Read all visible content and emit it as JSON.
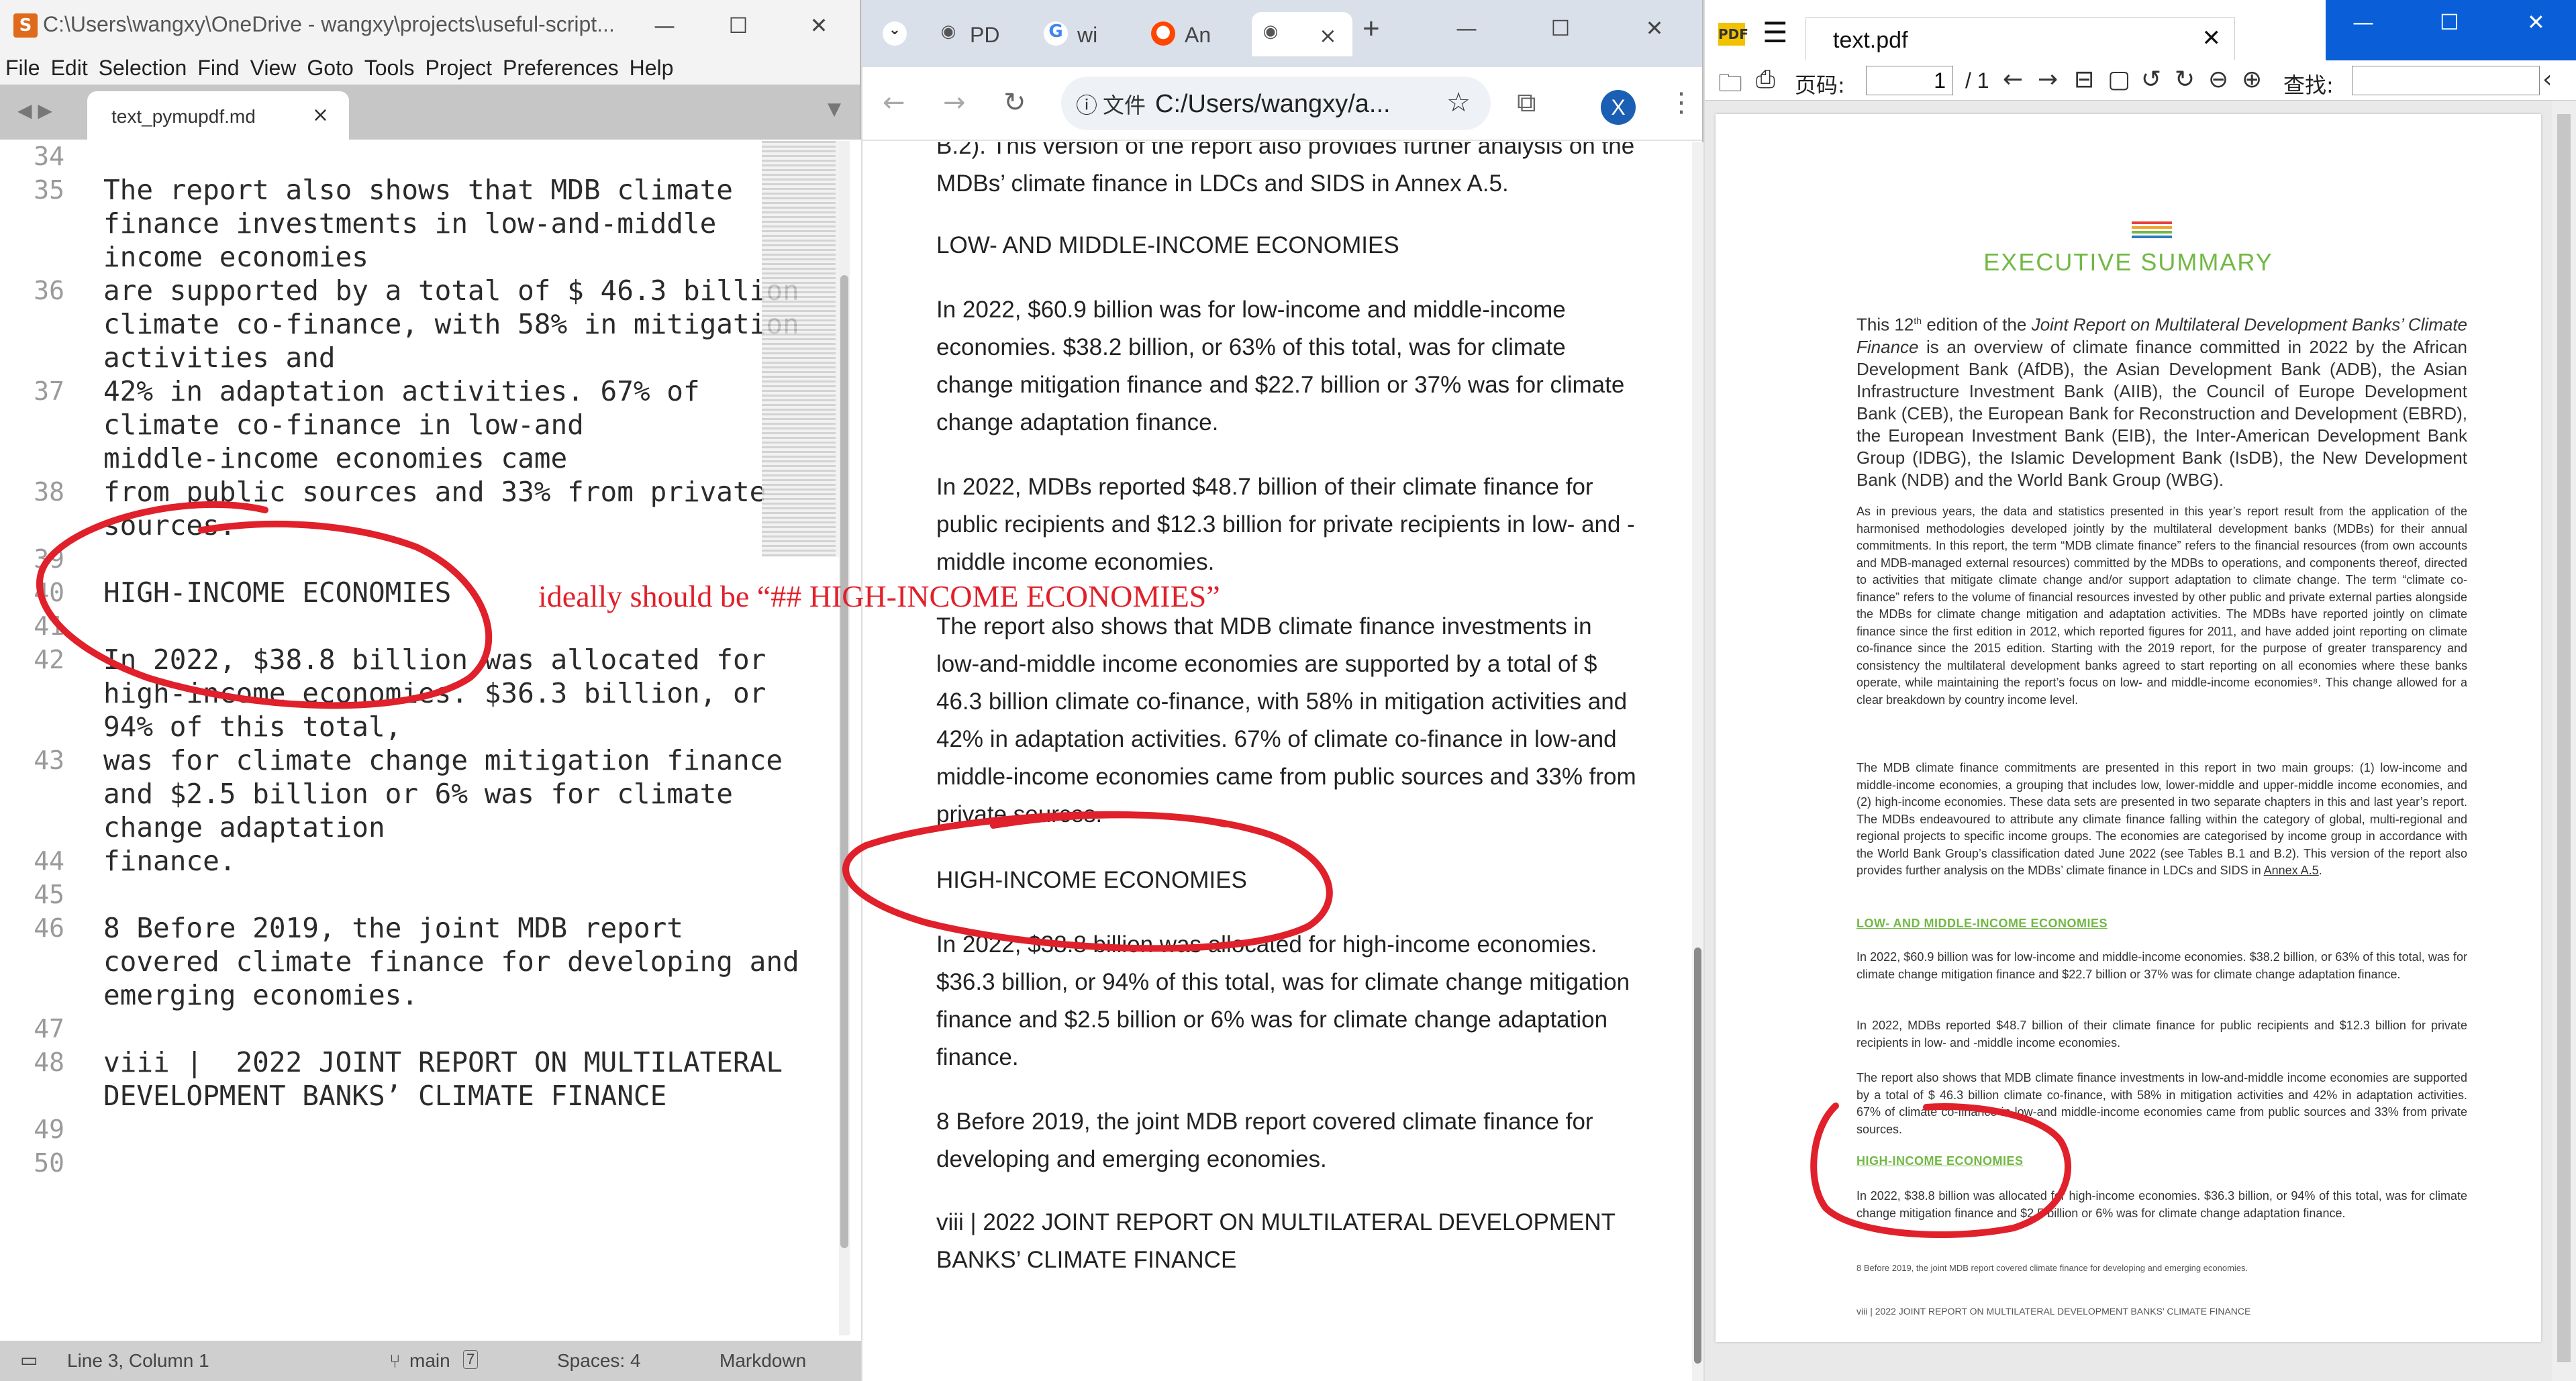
{
  "sublime": {
    "title": "C:\\Users\\wangxy\\OneDrive - wangxy\\projects\\useful-script...",
    "menu": [
      "File",
      "Edit",
      "Selection",
      "Find",
      "View",
      "Goto",
      "Tools",
      "Project",
      "Preferences",
      "Help"
    ],
    "tab": {
      "label": "text_pymupdf.md",
      "close": "×"
    },
    "lines": [
      {
        "num": "34",
        "text": ""
      },
      {
        "num": "35",
        "text": "The report also shows that MDB climate"
      },
      {
        "num": "",
        "text": "finance investments in low-and-middle"
      },
      {
        "num": "",
        "text": "income economies"
      },
      {
        "num": "36",
        "text": "are supported by a total of $ 46.3 billion"
      },
      {
        "num": "",
        "text": "climate co-finance, with 58% in mitigation"
      },
      {
        "num": "",
        "text": "activities and"
      },
      {
        "num": "37",
        "text": "42% in adaptation activities. 67% of"
      },
      {
        "num": "",
        "text": "climate co-finance in low-and"
      },
      {
        "num": "",
        "text": "middle-income economies came"
      },
      {
        "num": "38",
        "text": "from public sources and 33% from private"
      },
      {
        "num": "",
        "text": "sources."
      },
      {
        "num": "39",
        "text": ""
      },
      {
        "num": "40",
        "text": "HIGH-INCOME ECONOMIES"
      },
      {
        "num": "41",
        "text": ""
      },
      {
        "num": "42",
        "text": "In 2022, $38.8 billion was allocated for"
      },
      {
        "num": "",
        "text": "high-income economies. $36.3 billion, or"
      },
      {
        "num": "",
        "text": "94% of this total,"
      },
      {
        "num": "43",
        "text": "was for climate change mitigation finance"
      },
      {
        "num": "",
        "text": "and $2.5 billion or 6% was for climate"
      },
      {
        "num": "",
        "text": "change adaptation"
      },
      {
        "num": "44",
        "text": "finance."
      },
      {
        "num": "45",
        "text": ""
      },
      {
        "num": "46",
        "text": "8 Before 2019, the joint MDB report"
      },
      {
        "num": "",
        "text": "covered climate finance for developing and"
      },
      {
        "num": "",
        "text": "emerging economies."
      },
      {
        "num": "47",
        "text": ""
      },
      {
        "num": "48",
        "text": "viii |  2022 JOINT REPORT ON MULTILATERAL"
      },
      {
        "num": "",
        "text": "DEVELOPMENT BANKS’ CLIMATE FINANCE"
      },
      {
        "num": "49",
        "text": ""
      },
      {
        "num": "50",
        "text": ""
      }
    ],
    "status": {
      "position": "Line 3, Column 1",
      "branch": "main",
      "branch_badge": "7",
      "spaces": "Spaces: 4",
      "syntax": "Markdown"
    }
  },
  "annotation": {
    "note": "ideally should be “## HIGH-INCOME ECONOMIES”",
    "ink_color": "#e0202a"
  },
  "chrome": {
    "tabs": [
      {
        "label": "PD",
        "icon": "globe-icon"
      },
      {
        "label": "wi",
        "icon": "google-icon"
      },
      {
        "label": "An",
        "icon": "reddit-icon"
      },
      {
        "label": "",
        "icon": "globe-icon",
        "close": "×"
      }
    ],
    "new_tab": "+",
    "info_label": "文件",
    "url": "C:/Users/wangxy/a...",
    "avatar": "X",
    "paragraphs": [
      "B.2). This version of the report also provides further analysis on the MDBs’ climate finance in LDCs and SIDS in Annex A.5.",
      "LOW- AND MIDDLE-INCOME ECONOMIES",
      "In 2022, $60.9 billion was for low-income and middle-income economies. $38.2 billion, or 63% of this total, was for climate change mitigation finance and $22.7 billion or 37% was for climate change adaptation finance.",
      "In 2022, MDBs reported $48.7 billion of their climate finance for public recipients and $12.3 billion for private recipients in low- and -middle income economies.",
      "The report also shows that MDB climate finance investments in low-and-middle income economies are supported by a total of $ 46.3 billion climate co-finance, with 58% in mitigation activities and 42% in adaptation activities. 67% of climate co-finance in low-and middle-income economies came from public sources and 33% from private sources.",
      "HIGH-INCOME ECONOMIES",
      "In 2022, $38.8 billion was allocated for high-income economies. $36.3 billion, or 94% of this total, was for climate change mitigation finance and $2.5 billion or 6% was for climate change adaptation finance.",
      "8 Before 2019, the joint MDB report covered climate finance for developing and emerging economies.",
      "viii | 2022 JOINT REPORT ON MULTILATERAL DEVELOPMENT BANKS’ CLIMATE FINANCE"
    ]
  },
  "pdf": {
    "tab_title": "text.pdf",
    "page_label": "页码:",
    "page_value": "1",
    "page_total": "/ 1",
    "find_label": "查找:",
    "heading": "EXECUTIVE SUMMARY",
    "intro_pre": "This 12",
    "intro_sup": "th",
    "intro_mid": " edition of the ",
    "intro_em": "Joint Report on Multilateral Development Banks’ Climate Finance",
    "intro_post": " is an overview of climate finance committed in 2022 by the African Development Bank (AfDB), the Asian Development Bank (ADB), the Asian Infrastructure Investment Bank (AIIB), the Council of Europe Development Bank (CEB), the European Bank for Reconstruction and Development (EBRD), the European Investment Bank (EIB), the Inter-American Development Bank Group (IDBG), the Islamic Development Bank (IsDB), the New Development Bank (NDB) and the World Bank Group (WBG).",
    "p2": "As in previous years, the data and statistics presented in this year’s report result from the application of the harmonised methodologies developed jointly by the multilateral development banks (MDBs) for their annual commitments. In this report, the term “MDB climate finance” refers to the financial resources (from own accounts and MDB-managed external resources) committed by the MDBs to operations, and components thereof, directed to activities that mitigate climate change and/or support adaptation to climate change. The term “climate co-finance” refers to the volume of financial resources invested by other public and private external parties alongside the MDBs for climate change mitigation and adaptation activities. The MDBs have reported jointly on climate finance since the first edition in 2012, which reported figures for 2011, and have added joint reporting on climate co-finance since the 2015 edition. Starting with the 2019 report, for the purpose of greater transparency and consistency the multilateral development banks agreed to start reporting on all economies where these banks operate, while maintaining the report’s focus on low- and middle-income economies⁸. This change allowed for a clear breakdown by country income level.",
    "p3_pre": "The MDB climate finance commitments are presented in this report in two main groups: (1) low-income and middle-income economies, a grouping that includes low, lower-middle and upper-middle income economies, and (2) high-income economies. These data sets are presented in two separate chapters in this and last year’s report. The MDBs endeavoured to attribute any climate finance falling within the category of global, multi-regional and regional projects to specific income groups. The economies are categorised by income group in accordance with the World Bank Group’s classification dated June 2022 (see Tables B.1 and B.2). This version of the report also provides further analysis on the MDBs’ climate finance in LDCs and SIDS in ",
    "p3_link": "Annex A.5",
    "p3_post": ".",
    "h2": "LOW- AND MIDDLE-INCOME ECONOMIES",
    "p4": "In 2022, $60.9 billion was for low-income and middle-income economies. $38.2 billion, or 63% of this total, was for climate change mitigation finance and $22.7 billion or 37% was for climate change adaptation finance.",
    "p5": "In 2022, MDBs reported $48.7 billion of their climate finance for public recipients and $12.3 billion for private recipients in low- and -middle income economies.",
    "p6": "The report also shows that MDB climate finance investments in low-and-middle income economies are supported by a total of $ 46.3 billion climate co-finance, with 58% in mitigation activities and 42% in adaptation activities. 67% of climate co-finance in low-and middle-income economies came from public sources and 33% from private sources.",
    "h3": "HIGH-INCOME ECONOMIES",
    "p7": "In 2022, $38.8 billion was allocated for high-income economies. $36.3 billion, or 94% of this total, was for climate change mitigation finance and $2.5 billion or 6% was for climate change adaptation finance.",
    "footnote": "8      Before 2019, the joint MDB report covered climate finance for developing and emerging economies.",
    "footer": "viii   |   2022 JOINT REPORT ON MULTILATERAL DEVELOPMENT BANKS’ CLIMATE FINANCE",
    "accent": "#72b844"
  }
}
